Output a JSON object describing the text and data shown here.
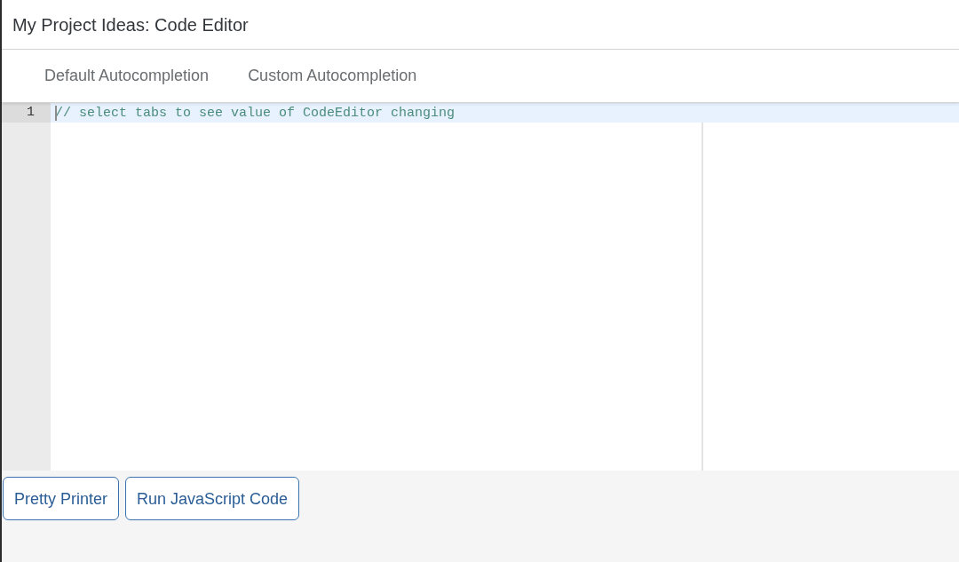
{
  "header": {
    "title": "My Project Ideas: Code Editor"
  },
  "tabs": [
    {
      "label": "Default Autocompletion",
      "selected": false
    },
    {
      "label": "Custom Autocompletion",
      "selected": false
    }
  ],
  "editor": {
    "lines": [
      {
        "number": "1",
        "text": "// select tabs to see value of CodeEditor changing",
        "active": true,
        "cursor": true
      }
    ]
  },
  "buttons": [
    "Pretty Printer",
    "Run JavaScript Code"
  ]
}
